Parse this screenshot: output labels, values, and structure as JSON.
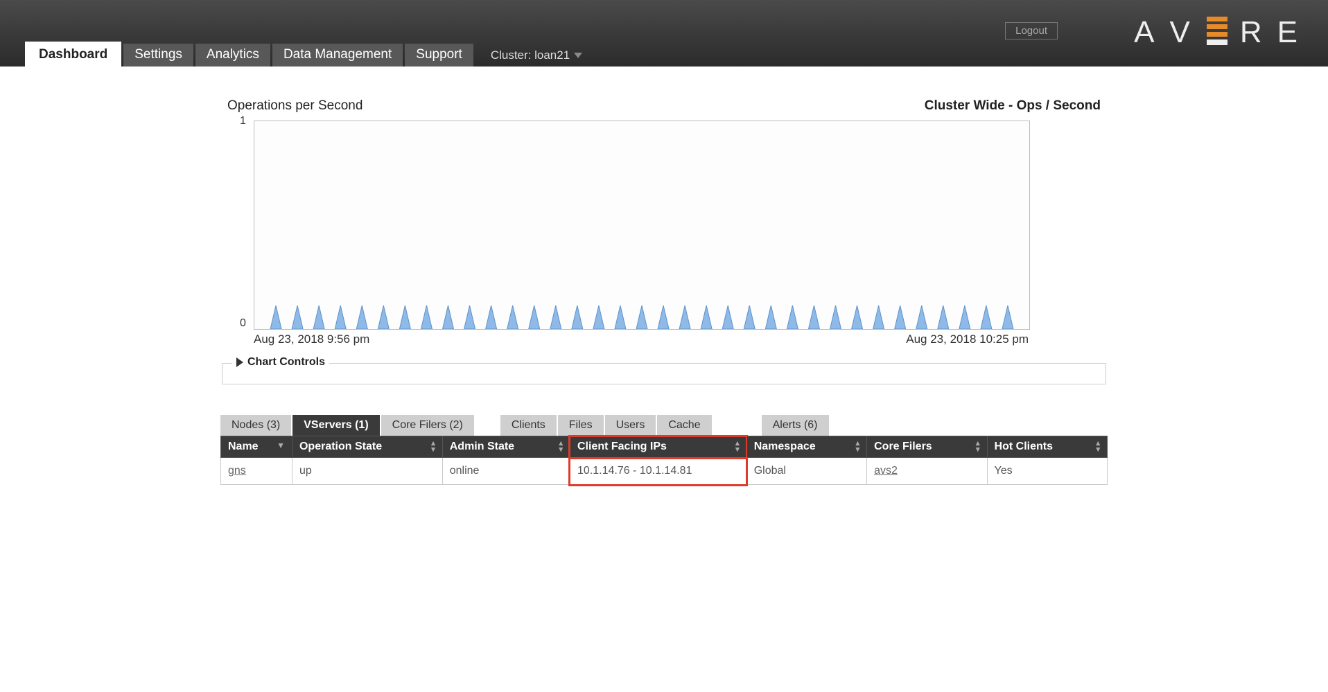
{
  "header": {
    "logout": "Logout",
    "tabs": [
      "Dashboard",
      "Settings",
      "Analytics",
      "Data Management",
      "Support"
    ],
    "active_tab": 0,
    "cluster_label": "Cluster: loan21"
  },
  "chart_head": {
    "left": "Operations per Second",
    "right": "Cluster Wide - Ops / Second"
  },
  "chart_data": {
    "type": "line",
    "title": "Operations per Second",
    "xlabel": "",
    "ylabel": "",
    "ylim": [
      0,
      1
    ],
    "yticks": [
      0,
      1
    ],
    "x_start": "Aug 23, 2018 9:56 pm",
    "x_end": "Aug 23, 2018 10:25 pm",
    "note": "~30 evenly spaced narrow spikes between ~0 and a small fraction of 1; values not labeled beyond axis ticks 0 and 1",
    "n_spikes": 35,
    "spike_approx_peak": 0.07
  },
  "controls_label": "Chart Controls",
  "subtabs": {
    "group1": [
      {
        "label": "Nodes (3)",
        "active": false
      },
      {
        "label": "VServers (1)",
        "active": true
      },
      {
        "label": "Core Filers (2)",
        "active": false
      }
    ],
    "group2": [
      {
        "label": "Clients",
        "active": false
      },
      {
        "label": "Files",
        "active": false
      },
      {
        "label": "Users",
        "active": false
      },
      {
        "label": "Cache",
        "active": false
      }
    ],
    "group3": [
      {
        "label": "Alerts (6)",
        "active": false
      }
    ]
  },
  "table": {
    "columns": [
      "Name",
      "Operation State",
      "Admin State",
      "Client Facing IPs",
      "Namespace",
      "Core Filers",
      "Hot Clients"
    ],
    "highlight_col": "Client Facing IPs",
    "rows": [
      {
        "name": "gns",
        "op_state": "up",
        "admin_state": "online",
        "client_ips": "10.1.14.76 - 10.1.14.81",
        "namespace": "Global",
        "core_filers": "avs2",
        "hot_clients": "Yes"
      }
    ]
  }
}
